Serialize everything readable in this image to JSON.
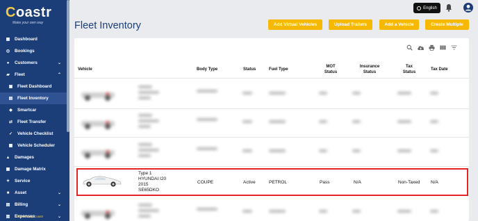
{
  "app": {
    "logo_text": "Coastr",
    "tagline": "Make your own way",
    "powered_by": "Powered by Coastr"
  },
  "topbar": {
    "language_label": "English",
    "bell_icon": "bell-icon",
    "avatar_icon": "user-icon"
  },
  "sidebar": {
    "items": [
      {
        "label": "Dashboard",
        "icon": "grid-icon",
        "sub": false
      },
      {
        "label": "Bookings",
        "icon": "book-icon",
        "sub": false
      },
      {
        "label": "Customers",
        "icon": "users-icon",
        "sub": false,
        "chevron": "down"
      },
      {
        "label": "Fleet",
        "icon": "car-icon",
        "sub": false,
        "chevron": "up"
      },
      {
        "label": "Fleet Dashboard",
        "icon": "dashboard-icon",
        "sub": true
      },
      {
        "label": "Fleet Inventory",
        "icon": "list-icon",
        "sub": true,
        "active": true
      },
      {
        "label": "Smartcar",
        "icon": "smartcar-icon",
        "sub": true
      },
      {
        "label": "Fleet Transfer",
        "icon": "transfer-icon",
        "sub": true
      },
      {
        "label": "Vehicle Checklist",
        "icon": "check-icon",
        "sub": true
      },
      {
        "label": "Vehicle Scheduler",
        "icon": "calendar-icon",
        "sub": true
      },
      {
        "label": "Damages",
        "icon": "damage-icon",
        "sub": false
      },
      {
        "label": "Damage Matrix",
        "icon": "matrix-icon",
        "sub": false
      },
      {
        "label": "Service",
        "icon": "wrench-icon",
        "sub": false
      },
      {
        "label": "Asset",
        "icon": "asset-icon",
        "sub": false,
        "chevron": "down"
      },
      {
        "label": "Billing",
        "icon": "billing-icon",
        "sub": false,
        "chevron": "down"
      },
      {
        "label": "Expenses",
        "icon": "expense-icon",
        "sub": false,
        "chevron": "down"
      }
    ]
  },
  "page": {
    "title": "Fleet Inventory",
    "buttons": {
      "add_virtual": "Add Virtual Vehicles",
      "upload_trailers": "Upload Trailers",
      "add_vehicle": "Add a Vehicle",
      "create_multiple": "Create Multiple"
    }
  },
  "table": {
    "columns": {
      "vehicle": "Vehicle",
      "body_type": "Body Type",
      "status": "Status",
      "fuel_type": "Fuel Type",
      "mot_status": "MOT Status",
      "insurance_status": "Insurance Status",
      "tax_status": "Tax Status",
      "tax_date": "Tax Date"
    },
    "highlighted_row": {
      "type": "Type 1",
      "model": "HYUNDAI I20",
      "year": "2015",
      "plate": "SE65DKO",
      "body_type": "COUPE",
      "status": "Active",
      "fuel_type": "PETROL",
      "mot_status": "Pass",
      "insurance_status": "N/A",
      "tax_status": "Non-Taxed",
      "tax_date": "N/A"
    }
  },
  "colors": {
    "sidebar": "#1b3d78",
    "accent": "#f7b900",
    "highlight": "#e52323"
  }
}
